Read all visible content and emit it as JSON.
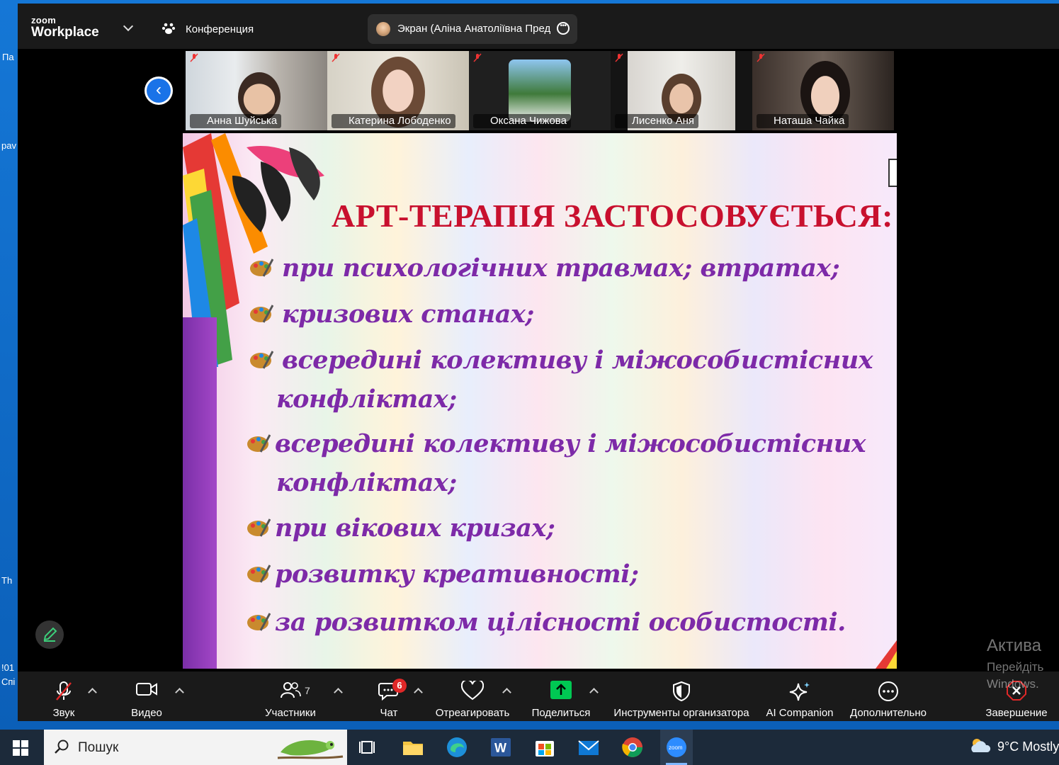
{
  "desktop": {
    "left_fragments": [
      "Па",
      "pav",
      "Th",
      "!01",
      "Спі"
    ]
  },
  "zoom": {
    "logo_top": "zoom",
    "logo_bottom": "Workplace",
    "meeting_label": "Конференция",
    "share_label": "Экран (Аліна Анатоліївна Пред",
    "participants": [
      {
        "name": "Анна Шуйська"
      },
      {
        "name": "Катерина Лободенко"
      },
      {
        "name": "Оксана Чижова"
      },
      {
        "name": "Лисенко Аня"
      },
      {
        "name": "Наташа Чайка"
      }
    ],
    "slide": {
      "title": "АРТ-ТЕРАПІЯ ЗАСТОСОВУЄТЬСЯ:",
      "bullets": [
        "при психологічних травмах; втратах;",
        "кризових станах;",
        "всередині  колективу  і  міжособистісних",
        "конфліктах;",
        "всередині  колективу  і  міжособистісних",
        "конфліктах;",
        "при вікових  кризах;",
        "розвитку креативності;",
        "за розвитком  цілісності  особистості."
      ]
    },
    "toolbar": {
      "audio": "Звук",
      "video": "Видео",
      "participants": "Участники",
      "participants_count": "7",
      "chat": "Чат",
      "chat_badge": "6",
      "react": "Отреагировать",
      "share": "Поделиться",
      "host_tools": "Инструменты организатора",
      "ai": "AI Companion",
      "more": "Дополнительно",
      "end": "Завершение"
    }
  },
  "activation": {
    "line1": "Актива",
    "line2": "Перейдіть",
    "line3": "Windows."
  },
  "taskbar": {
    "search_text": "Пошук",
    "weather": "9°C  Mostly"
  },
  "colors": {
    "zoom_bg": "#1a1a1a",
    "accent_blue": "#1a73e8",
    "title_red": "#c8102e",
    "bullet_purple": "#7d2aa8",
    "share_green": "#00c853",
    "badge_red": "#e02828"
  }
}
